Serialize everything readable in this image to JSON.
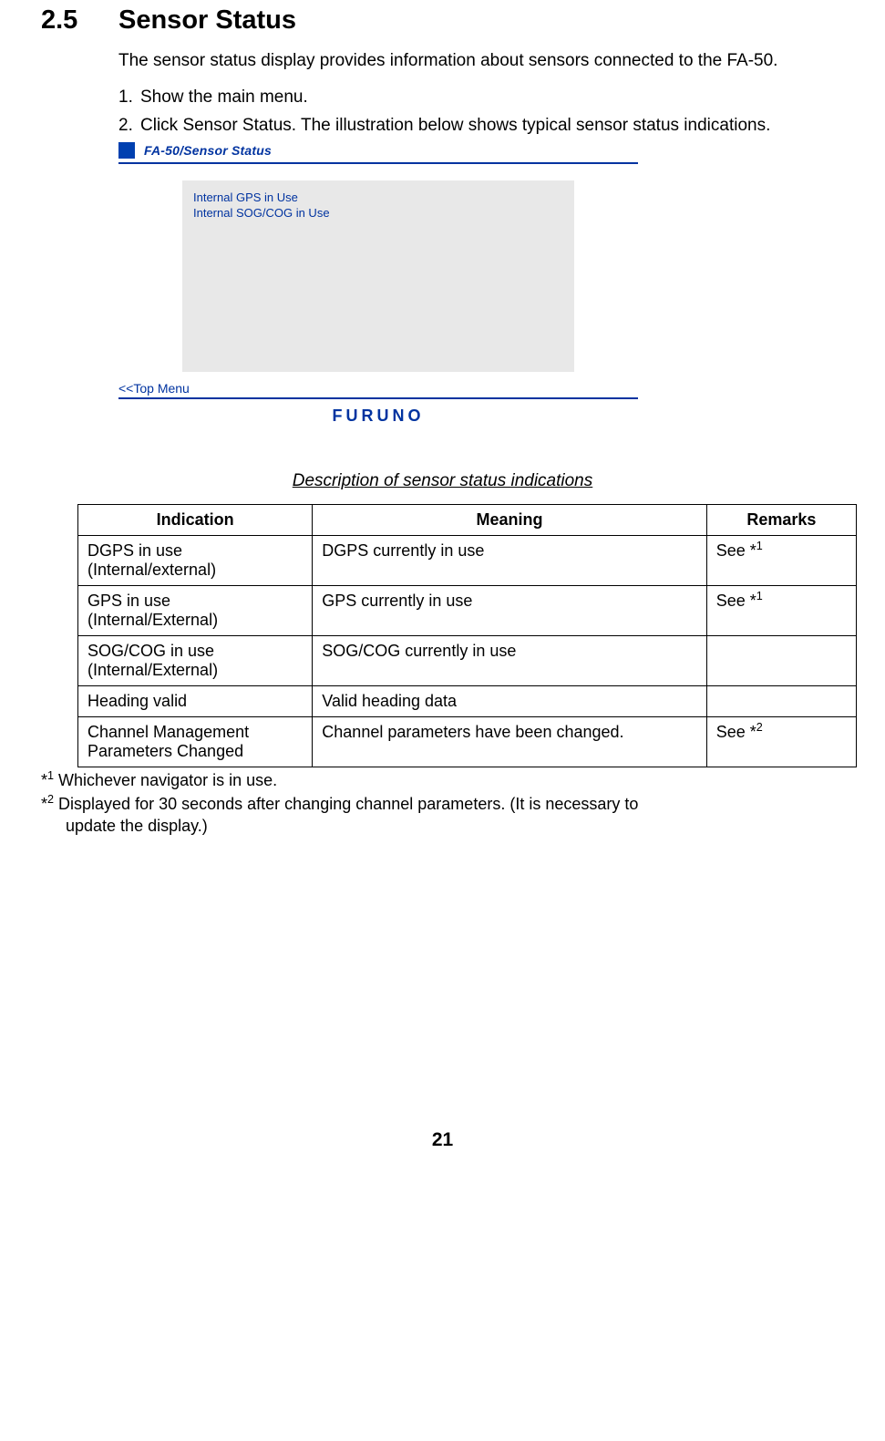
{
  "section": {
    "number": "2.5",
    "title": "Sensor Status"
  },
  "intro": "The sensor status display provides information about sensors connected to the FA-50.",
  "steps": [
    "Show the main menu.",
    "Click Sensor Status. The illustration below shows typical sensor status indications."
  ],
  "screenshot": {
    "title": "FA-50/Sensor Status",
    "status_lines": [
      "Internal GPS in Use",
      "Internal SOG/COG in Use"
    ],
    "top_menu": "<<Top Menu",
    "logo": "FURUNO"
  },
  "table_caption": "Description of sensor status indications",
  "table": {
    "headers": [
      "Indication",
      "Meaning",
      "Remarks"
    ],
    "rows": [
      {
        "indication": "DGPS in use\n(Internal/external)",
        "meaning": "DGPS currently in use",
        "remarks": "See *",
        "sup": "1"
      },
      {
        "indication": "GPS in use\n(Internal/External)",
        "meaning": "GPS currently in use",
        "remarks": "See *",
        "sup": "1"
      },
      {
        "indication": "SOG/COG in use\n(Internal/External)",
        "meaning": "SOG/COG currently in use",
        "remarks": "",
        "sup": ""
      },
      {
        "indication": "Heading valid",
        "meaning": "Valid heading data",
        "remarks": "",
        "sup": ""
      },
      {
        "indication": "Channel Management Parameters Changed",
        "meaning": "Channel parameters have been changed.",
        "remarks": "See *",
        "sup": "2"
      }
    ]
  },
  "footnotes": [
    {
      "mark": "1",
      "text": " Whichever navigator is in use."
    },
    {
      "mark": "2",
      "text": " Displayed for 30 seconds after changing channel parameters. (It is necessary to update the display.)"
    }
  ],
  "page_number": "21"
}
